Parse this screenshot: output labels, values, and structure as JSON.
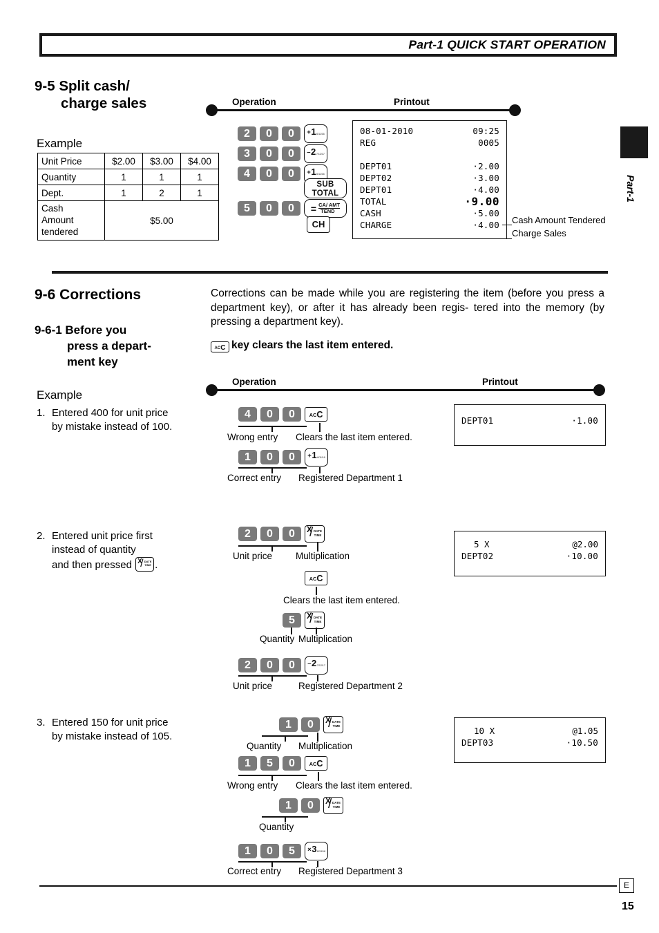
{
  "header": {
    "title": "Part-1 QUICK START OPERATION"
  },
  "side_tab": {
    "label": "Part-1"
  },
  "footer": {
    "lang_mark": "E",
    "page_number": "15"
  },
  "section_95": {
    "number_title_line1": "9-5  Split cash/",
    "number_title_line2": "charge sales",
    "example_label": "Example",
    "table": {
      "rows": [
        {
          "header": "Unit Price",
          "values": [
            "$2.00",
            "$3.00",
            "$4.00"
          ]
        },
        {
          "header": "Quantity",
          "values": [
            "1",
            "1",
            "1"
          ]
        },
        {
          "header": "Dept.",
          "values": [
            "1",
            "2",
            "1"
          ]
        }
      ],
      "tendered_header_lines": [
        "Cash",
        "Amount",
        "tendered"
      ],
      "tendered_value": "$5.00"
    },
    "rail": {
      "operation": "Operation",
      "printout": "Printout"
    },
    "key_rows": [
      {
        "digits": [
          "2",
          "0",
          "0"
        ],
        "fnkey": "dept-plus-1",
        "fn_main_sign": "+",
        "fn_main_num": "1",
        "fn_sub": "6/11/16"
      },
      {
        "digits": [
          "3",
          "0",
          "0"
        ],
        "fnkey": "dept-minus-2",
        "fn_main_sign": "–",
        "fn_main_num": "2",
        "fn_sub": "7/12/17"
      },
      {
        "digits": [
          "4",
          "0",
          "0"
        ],
        "fnkey": "dept-plus-1",
        "fn_main_sign": "+",
        "fn_main_num": "1",
        "fn_sub": "6/11/16"
      },
      {
        "digits": [],
        "fnkey": "sub-total",
        "fn_line1": "SUB",
        "fn_line2": "TOTAL"
      },
      {
        "digits": [
          "5",
          "0",
          "0"
        ],
        "fnkey": "cash-amt-tend",
        "fn_eq": "=",
        "fn_top": "CA/ AMT",
        "fn_bot": "TEND"
      },
      {
        "digits": [],
        "fnkey": "charge",
        "fn_label": "CH"
      }
    ],
    "receipt": {
      "lines": [
        {
          "left": "08-01-2010",
          "right": "09:25"
        },
        {
          "left": "REG",
          "right": "0005"
        },
        {
          "left": "",
          "right": ""
        },
        {
          "left": "DEPT01",
          "right": "·2.00"
        },
        {
          "left": "DEPT02",
          "right": "·3.00"
        },
        {
          "left": "DEPT01",
          "right": "·4.00"
        },
        {
          "left": "TOTAL",
          "right": "·9.00",
          "emphasis": true
        },
        {
          "left": "CASH",
          "right": "·5.00"
        },
        {
          "left": "CHARGE",
          "right": "·4.00"
        }
      ]
    },
    "callouts": [
      {
        "text": "Cash Amount Tendered"
      },
      {
        "text": "Charge Sales"
      }
    ]
  },
  "section_96": {
    "number_title": "9-6  Corrections",
    "intro": "Corrections can be made while you are registering the item (before you press a department key), or after it has already been regis- tered  into the memory (by pressing a department key).",
    "ac_note": "key clears the last item entered.",
    "sub_section": {
      "number_title_line1": "9-6-1  Before you",
      "number_title_line2": "press a depart-",
      "number_title_line3": "ment key"
    },
    "example_label": "Example",
    "rail": {
      "operation": "Operation",
      "printout": "Printout"
    },
    "items": [
      {
        "number": "1.",
        "text": "Entered 400 for unit price by mistake instead of 100.",
        "steps": [
          {
            "digits": [
              "4",
              "0",
              "0"
            ],
            "key": "ac-c",
            "label_left": "Wrong entry",
            "label_right": "Clears the last item entered."
          },
          {
            "digits": [
              "1",
              "0",
              "0"
            ],
            "key": "dept-plus-1",
            "label_left": "Correct entry",
            "label_right": "Registered Department 1"
          }
        ],
        "receipt": {
          "lines": [
            {
              "left": "DEPT01",
              "right": "·1.00"
            }
          ]
        }
      },
      {
        "number": "2.",
        "text_lines": [
          "Entered unit price first",
          "instead of quantity",
          "and then pressed"
        ],
        "text_suffix": ".",
        "steps": [
          {
            "digits": [
              "2",
              "0",
              "0"
            ],
            "key": "multiplication",
            "label_left": "Unit price",
            "label_right": "Multiplication"
          },
          {
            "digits": [],
            "key": "ac-c",
            "label_left": "",
            "label_right": "Clears the last item entered."
          },
          {
            "digits": [
              "5"
            ],
            "key": "multiplication",
            "label_left": "Quantity",
            "label_right": "Multiplication"
          },
          {
            "digits": [
              "2",
              "0",
              "0"
            ],
            "key": "dept-minus-2",
            "label_left": "Unit price",
            "label_right": "Registered Department 2"
          }
        ],
        "receipt": {
          "lines": [
            {
              "left": "5 X",
              "right": "@2.00",
              "centered": true
            },
            {
              "left": "DEPT02",
              "right": "·10.00"
            }
          ]
        }
      },
      {
        "number": "3.",
        "text": "Entered 150 for unit price by mistake instead of 105.",
        "steps": [
          {
            "digits": [
              "1",
              "0"
            ],
            "key": "multiplication",
            "label_left": "Quantity",
            "label_right": "Multiplication"
          },
          {
            "digits": [
              "1",
              "5",
              "0"
            ],
            "key": "ac-c",
            "label_left": "Wrong entry",
            "label_right": "Clears the last item entered."
          },
          {
            "digits": [
              "1",
              "0"
            ],
            "key": "multiplication",
            "label_left": "Quantity",
            "label_right": ""
          },
          {
            "digits": [
              "1",
              "0",
              "5"
            ],
            "key": "dept-times-3",
            "label_left": "Correct entry",
            "label_right": "Registered Department 3"
          }
        ],
        "receipt": {
          "lines": [
            {
              "left": "10 X",
              "right": "@1.05",
              "centered": true
            },
            {
              "left": "DEPT03",
              "right": "·10.50"
            }
          ]
        }
      }
    ]
  },
  "keys": {
    "ac_c_ac": "AC",
    "ac_c_c": "C",
    "mul_x": "X",
    "mul_date": "DATE",
    "mul_time": "TIME",
    "dept3_sign": "×",
    "dept3_num": "3",
    "dept3_sub": "8/13/18"
  }
}
